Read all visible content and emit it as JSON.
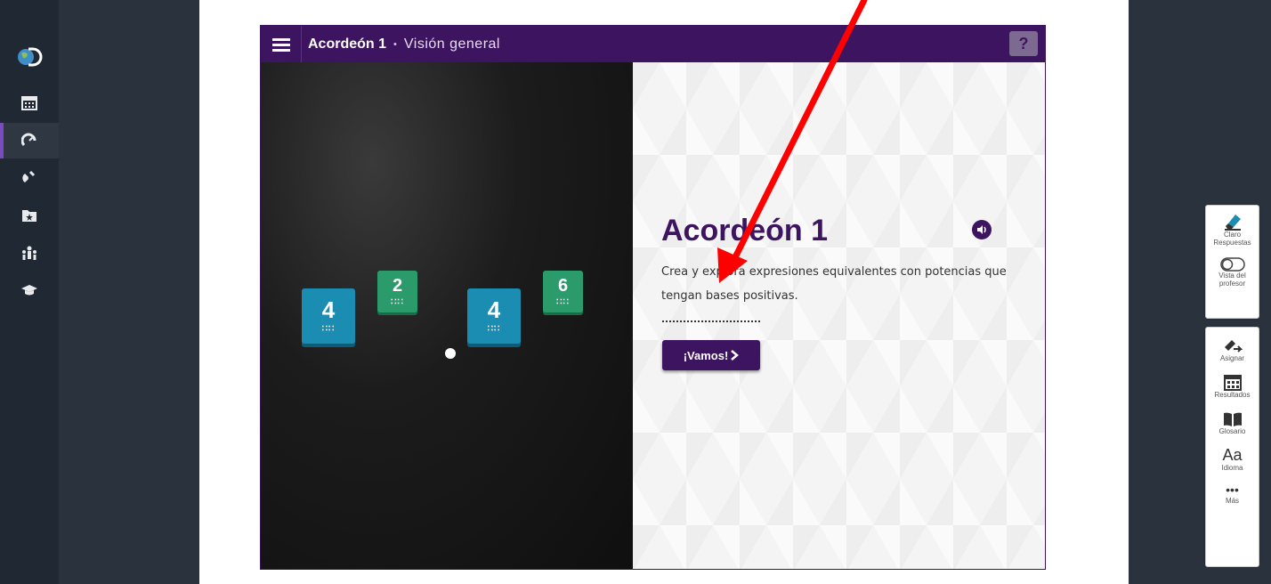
{
  "header": {
    "title": "Acordeón 1",
    "separator": "•",
    "subtitle": "Visión general",
    "help_label": "?"
  },
  "activity": {
    "title": "Acordeón 1",
    "description": "Crea y explora expresiones equivalentes con potencias que tengan bases positivas.",
    "go_button": "¡Vamos!"
  },
  "expression": {
    "term1": {
      "base": "4",
      "exponent": "2"
    },
    "operator": "•",
    "term2": {
      "base": "4",
      "exponent": "6"
    },
    "dots": "∷∷"
  },
  "sidebar": {
    "icons": [
      "discovery-logo",
      "calendar-icon",
      "gauge-icon",
      "magnet-icon",
      "starred-folder-icon",
      "group-icon",
      "graduation-cap-icon"
    ]
  },
  "tools": {
    "clear_answers": "Claro Respuestas",
    "teacher_view": "Vista del profesor",
    "assign": "Asignar",
    "results": "Resultados",
    "glossary": "Glosario",
    "language_glyph": "Aa",
    "language": "Idioma",
    "more_glyph": "•••",
    "more": "Más"
  },
  "colors": {
    "brand_purple": "#3d145f",
    "tile_blue": "#1b8db2",
    "tile_green": "#2c9b6c",
    "annotation_red": "#ff0000"
  }
}
